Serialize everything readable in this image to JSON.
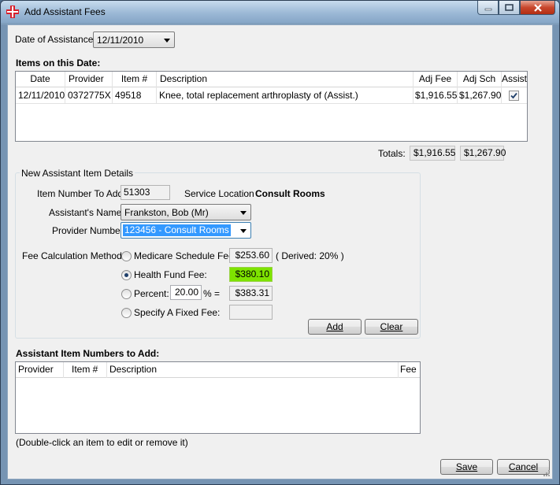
{
  "window": {
    "title": "Add Assistant Fees"
  },
  "date_of_assistance": {
    "label": "Date of Assistance",
    "value": "12/11/2010"
  },
  "items_section": {
    "title": "Items on this Date:",
    "columns": [
      "Date",
      "Provider",
      "Item #",
      "Description",
      "Adj Fee",
      "Adj Sch",
      "Assisted"
    ],
    "rows": [
      {
        "date": "12/11/2010",
        "provider": "0372775X",
        "item": "49518",
        "description": "Knee, total replacement arthroplasty of (Assist.)",
        "adj_fee": "$1,916.55",
        "adj_sch": "$1,267.90",
        "assisted": true
      }
    ],
    "totals": {
      "label": "Totals:",
      "adj_fee": "$1,916.55",
      "adj_sch": "$1,267.90"
    }
  },
  "details": {
    "group_title": "New Assistant Item Details",
    "item_number_label": "Item Number To Add",
    "item_number_value": "51303",
    "service_location_label": "Service Location",
    "service_location_value": "Consult Rooms",
    "assistant_name_label": "Assistant's Name",
    "assistant_name_value": "Frankston, Bob (Mr)",
    "provider_number_label": "Provider Number",
    "provider_number_value": "123456 - Consult Rooms",
    "fee_method_label": "Fee Calculation Method:",
    "methods": {
      "medicare": {
        "label": "Medicare Schedule Fee:",
        "value": "$253.60",
        "note": "( Derived: 20% )"
      },
      "health_fund": {
        "label": "Health Fund Fee:",
        "value": "$380.10"
      },
      "percent": {
        "label": "Percent:",
        "input": "20.00",
        "suffix": "% =",
        "value": "$383.31"
      },
      "fixed": {
        "label": "Specify A Fixed Fee:",
        "value": ""
      }
    },
    "selected_method": "health_fund",
    "add_button": "Add",
    "clear_button": "Clear"
  },
  "to_add_section": {
    "title": "Assistant Item Numbers to Add:",
    "columns": [
      "Provider",
      "Item #",
      "Description",
      "Fee"
    ],
    "hint": "(Double-click an item to edit or remove it)"
  },
  "footer": {
    "save_button": "Save",
    "cancel_button": "Cancel"
  },
  "colors": {
    "highlight_green": "#7ee300",
    "selection_blue": "#3399ff",
    "close_red": "#c8472d"
  }
}
